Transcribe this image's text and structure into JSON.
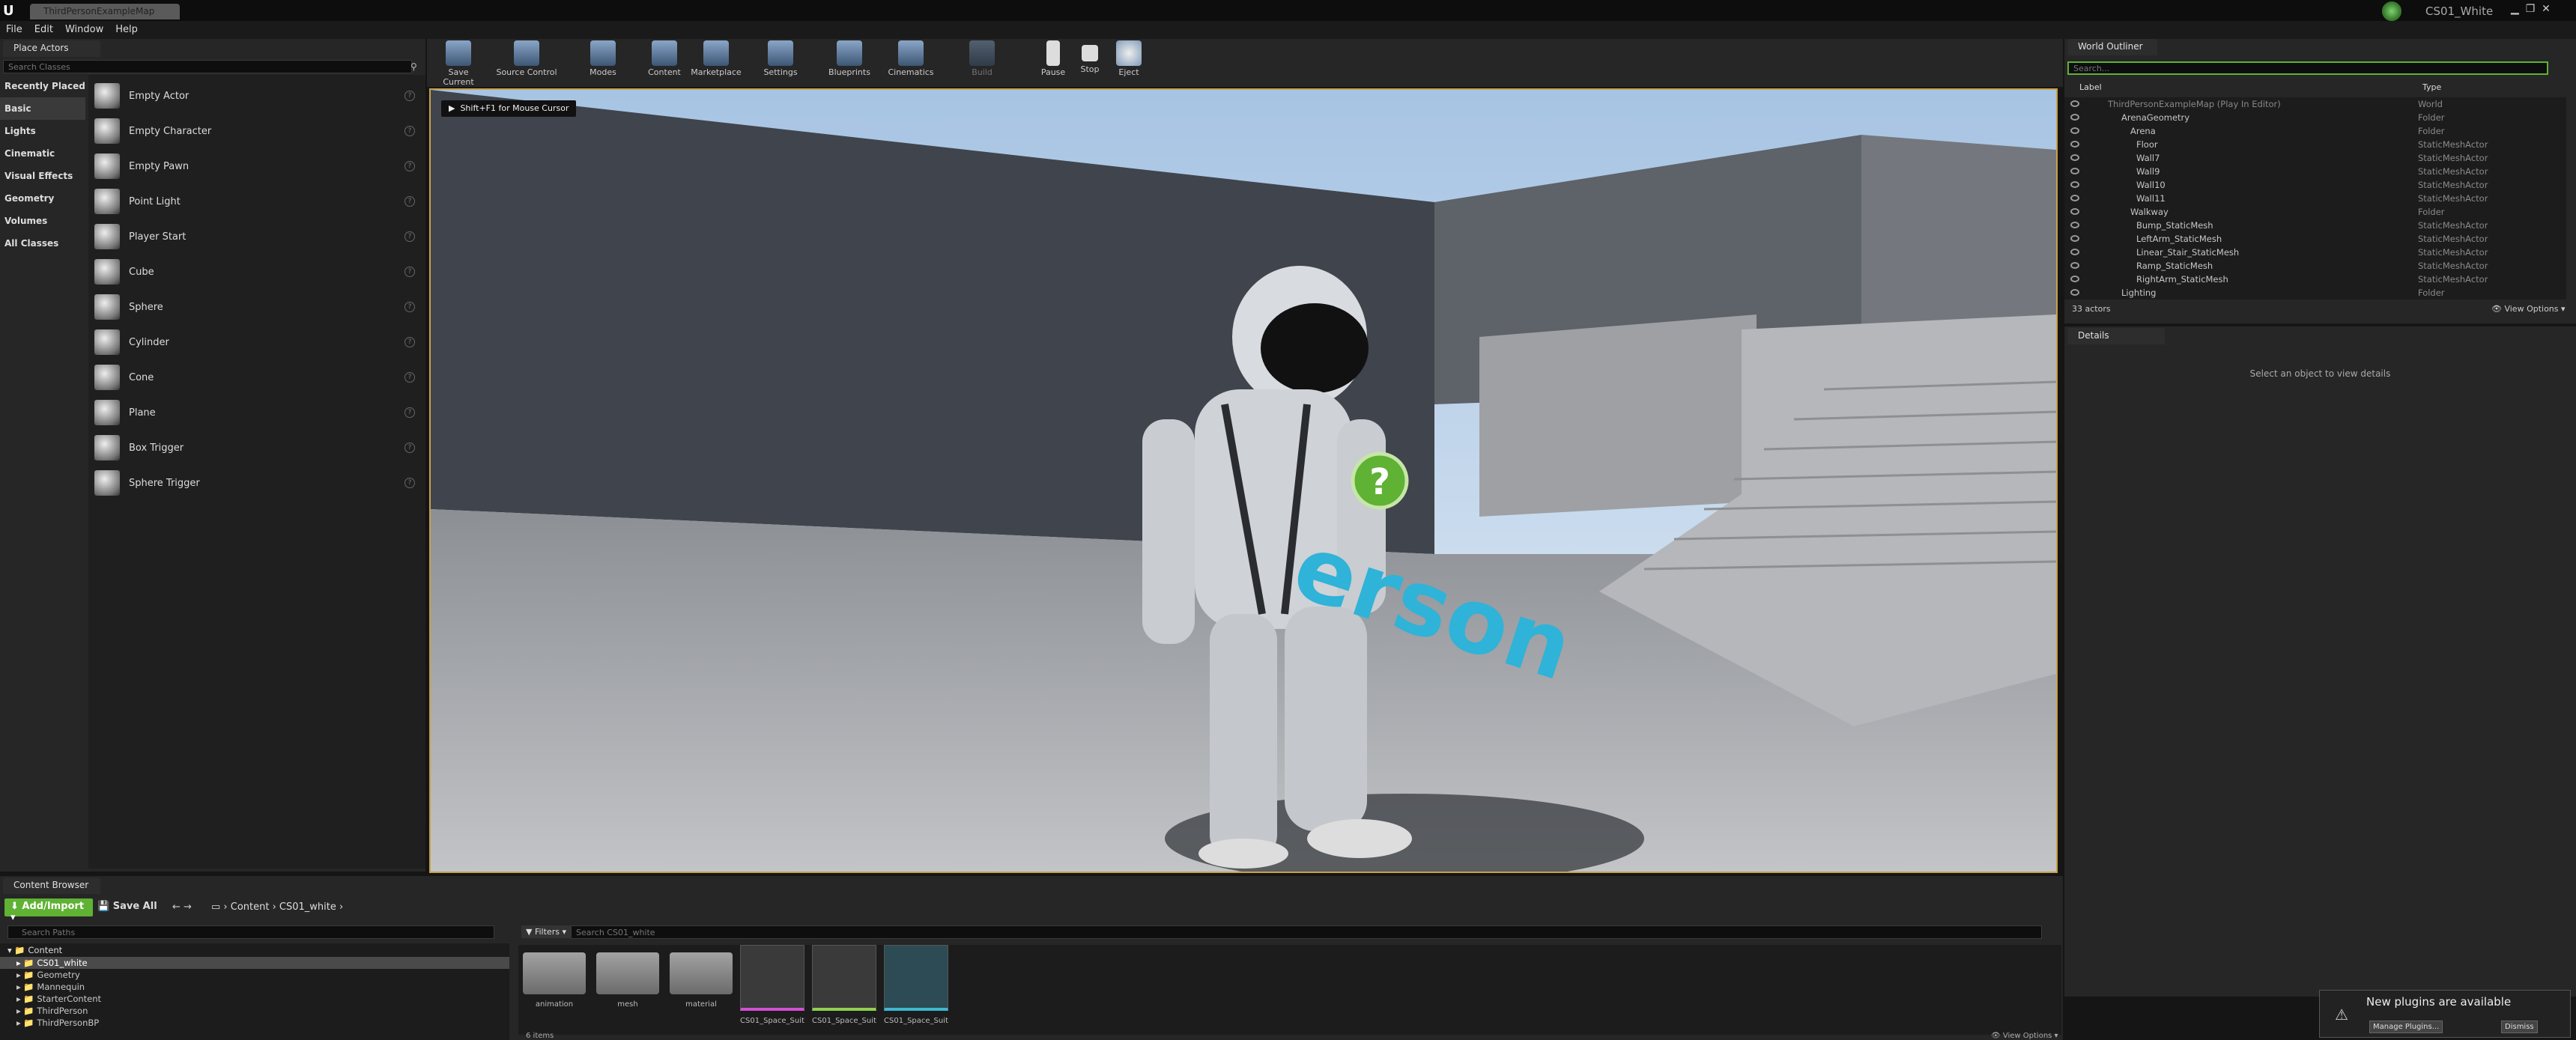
{
  "window": {
    "tab_title": "ThirdPersonExampleMap",
    "project_name": "CS01_White"
  },
  "menu": [
    "File",
    "Edit",
    "Window",
    "Help"
  ],
  "place_actors": {
    "tab": "Place Actors",
    "search_placeholder": "Search Classes",
    "categories": [
      "Recently Placed",
      "Basic",
      "Lights",
      "Cinematic",
      "Visual Effects",
      "Geometry",
      "Volumes",
      "All Classes"
    ],
    "selected_category": "Basic",
    "items": [
      "Empty Actor",
      "Empty Character",
      "Empty Pawn",
      "Point Light",
      "Player Start",
      "Cube",
      "Sphere",
      "Cylinder",
      "Cone",
      "Plane",
      "Box Trigger",
      "Sphere Trigger"
    ]
  },
  "toolbar": [
    {
      "label": "Save Current",
      "icon": "save-icon"
    },
    {
      "label": "Source Control",
      "icon": "source-control-icon"
    },
    {
      "label": "Modes",
      "icon": "modes-icon"
    },
    {
      "label": "Content",
      "icon": "content-icon"
    },
    {
      "label": "Marketplace",
      "icon": "marketplace-icon"
    },
    {
      "label": "Settings",
      "icon": "settings-icon"
    },
    {
      "label": "Blueprints",
      "icon": "blueprints-icon"
    },
    {
      "label": "Cinematics",
      "icon": "cinematics-icon"
    },
    {
      "label": "Build",
      "icon": "build-icon"
    },
    {
      "label": "Pause",
      "icon": "pause-icon"
    },
    {
      "label": "Stop",
      "icon": "stop-icon"
    },
    {
      "label": "Eject",
      "icon": "eject-icon"
    }
  ],
  "viewport": {
    "hint": "Shift+F1 for Mouse Cursor",
    "floor_text": "erson"
  },
  "world_outliner": {
    "tab": "World Outliner",
    "search_placeholder": "Search...",
    "col_label": "Label",
    "col_type": "Type",
    "rows": [
      {
        "label": "ThirdPersonExampleMap (Play In Editor)",
        "type": "World"
      },
      {
        "label": "ArenaGeometry",
        "type": "Folder"
      },
      {
        "label": "Arena",
        "type": "Folder"
      },
      {
        "label": "Floor",
        "type": "StaticMeshActor"
      },
      {
        "label": "Wall7",
        "type": "StaticMeshActor"
      },
      {
        "label": "Wall9",
        "type": "StaticMeshActor"
      },
      {
        "label": "Wall10",
        "type": "StaticMeshActor"
      },
      {
        "label": "Wall11",
        "type": "StaticMeshActor"
      },
      {
        "label": "Walkway",
        "type": "Folder"
      },
      {
        "label": "Bump_StaticMesh",
        "type": "StaticMeshActor"
      },
      {
        "label": "LeftArm_StaticMesh",
        "type": "StaticMeshActor"
      },
      {
        "label": "Linear_Stair_StaticMesh",
        "type": "StaticMeshActor"
      },
      {
        "label": "Ramp_StaticMesh",
        "type": "StaticMeshActor"
      },
      {
        "label": "RightArm_StaticMesh",
        "type": "StaticMeshActor"
      },
      {
        "label": "Lighting",
        "type": "Folder"
      }
    ],
    "actor_count": "33 actors",
    "view_options": "View Options"
  },
  "details": {
    "tab": "Details",
    "empty_msg": "Select an object to view details"
  },
  "content_browser": {
    "tab": "Content Browser",
    "add_import": "Add/Import",
    "save_all": "Save All",
    "crumbs": [
      "Content",
      "CS01_white"
    ],
    "search_paths_placeholder": "Search Paths",
    "filters": "Filters",
    "search_placeholder": "Search CS01_white",
    "tree": [
      "Content",
      "CS01_white",
      "Geometry",
      "Mannequin",
      "StarterContent",
      "ThirdPerson",
      "ThirdPersonBP"
    ],
    "assets": [
      "animation",
      "mesh",
      "material",
      "CS01_Space_Suit",
      "CS01_Space_Suit",
      "CS01_Space_Suit"
    ],
    "item_count": "6 items",
    "view_options": "View Options"
  },
  "notification": {
    "title": "New plugins are available",
    "manage": "Manage Plugins...",
    "dismiss": "Dismiss"
  },
  "colors": {
    "accent_green": "#5fb233",
    "viewport_border": "#c8a14a",
    "floor_blue": "#2fb3d8"
  }
}
